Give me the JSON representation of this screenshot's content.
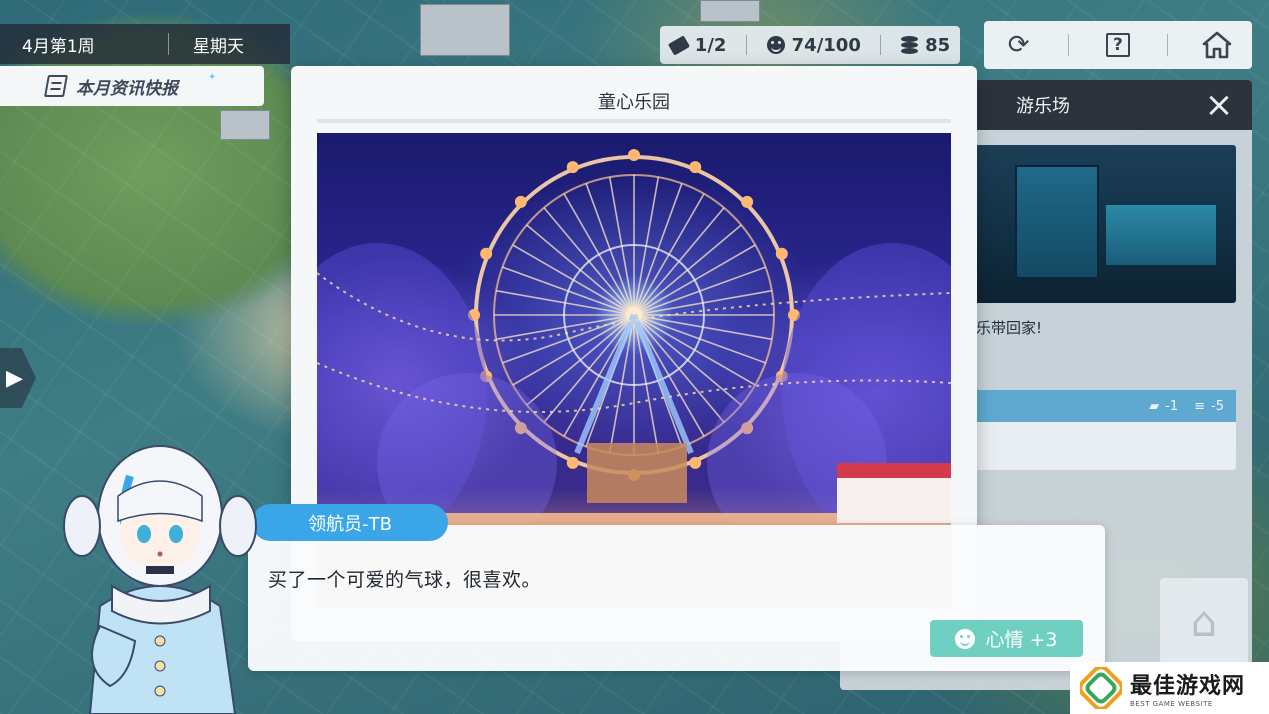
{
  "calendar": {
    "week": "4月第1周",
    "weekday": "星期天"
  },
  "news": {
    "label": "本月资讯快报"
  },
  "resources": {
    "tickets": "1/2",
    "mood": "74/100",
    "coins": "85"
  },
  "nav": {
    "refresh_icon": "refresh-icon",
    "help_label": "?",
    "home_icon": "home-icon"
  },
  "side_panel": {
    "title": "游乐场",
    "description": "乐带回家!",
    "cost_tickets": "-1",
    "cost_coins": "-5"
  },
  "dialog": {
    "title": "童心乐园"
  },
  "dialogue": {
    "speaker": "领航员-TB",
    "text": "买了一个可爱的气球，很喜欢。",
    "reward": "心情 +3"
  },
  "watermark": {
    "cn": "最佳游戏网",
    "en": "BEST GAME WEBSITE"
  },
  "colors": {
    "accent_blue": "#3aa6e8",
    "mood_green": "#6fd0c2",
    "panel_dark": "#2d333d"
  }
}
